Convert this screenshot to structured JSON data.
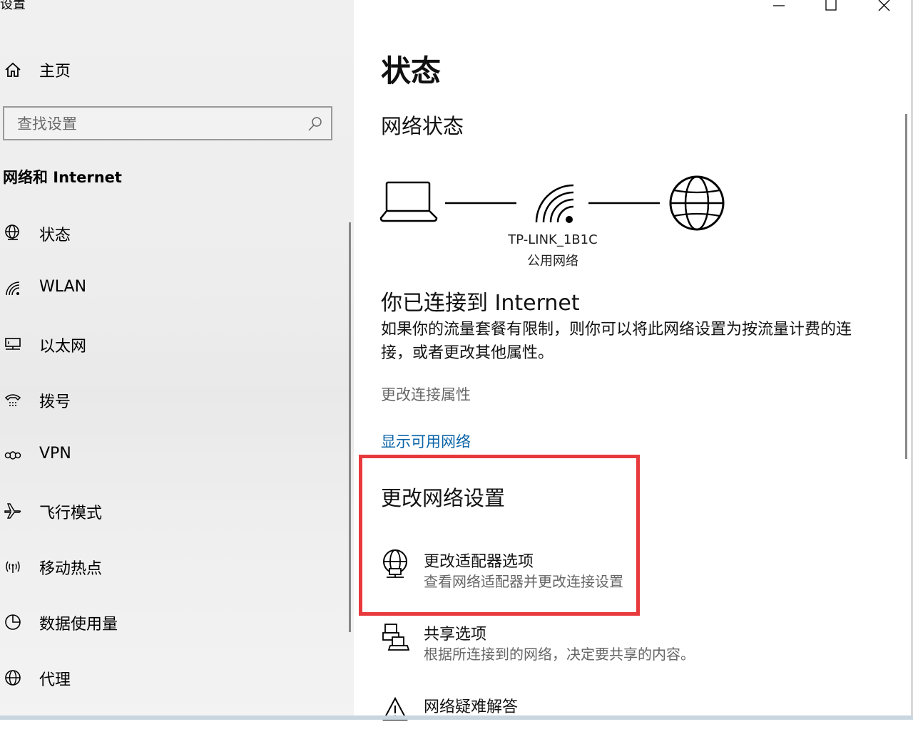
{
  "window": {
    "title": "设置",
    "controls": [
      "minimize-icon",
      "maximize-icon",
      "close-icon"
    ]
  },
  "sidebar": {
    "home_label": "主页",
    "search_placeholder": "查找设置",
    "section_heading": "网络和 Internet",
    "items": [
      {
        "label": "状态",
        "icon": "globe-status-icon"
      },
      {
        "label": "WLAN",
        "icon": "wifi-icon"
      },
      {
        "label": "以太网",
        "icon": "ethernet-icon"
      },
      {
        "label": "拨号",
        "icon": "dialup-icon"
      },
      {
        "label": "VPN",
        "icon": "vpn-icon"
      },
      {
        "label": "飞行模式",
        "icon": "airplane-icon"
      },
      {
        "label": "移动热点",
        "icon": "hotspot-icon"
      },
      {
        "label": "数据使用量",
        "icon": "data-usage-icon"
      },
      {
        "label": "代理",
        "icon": "globe-icon"
      }
    ]
  },
  "main": {
    "title": "状态",
    "network_status_heading": "网络状态",
    "ssid": "TP-LINK_1B1C",
    "network_type": "公用网络",
    "connected_heading": "你已连接到 Internet",
    "connected_desc": "如果你的流量套餐有限制，则你可以将此网络设置为按流量计费的连接，或者更改其他属性。",
    "change_props_link": "更改连接属性",
    "show_networks_link": "显示可用网络",
    "change_settings_heading": "更改网络设置",
    "options": [
      {
        "title": "更改适配器选项",
        "desc": "查看网络适配器并更改连接设置",
        "icon": "adapter-globe-icon"
      },
      {
        "title": "共享选项",
        "desc": "根据所连接到的网络，决定要共享的内容。",
        "icon": "sharing-icon"
      },
      {
        "title": "网络疑难解答",
        "desc": "",
        "icon": "warning-icon"
      }
    ],
    "colors": {
      "link": "#0a64a8",
      "highlight": "#e8393d"
    }
  }
}
